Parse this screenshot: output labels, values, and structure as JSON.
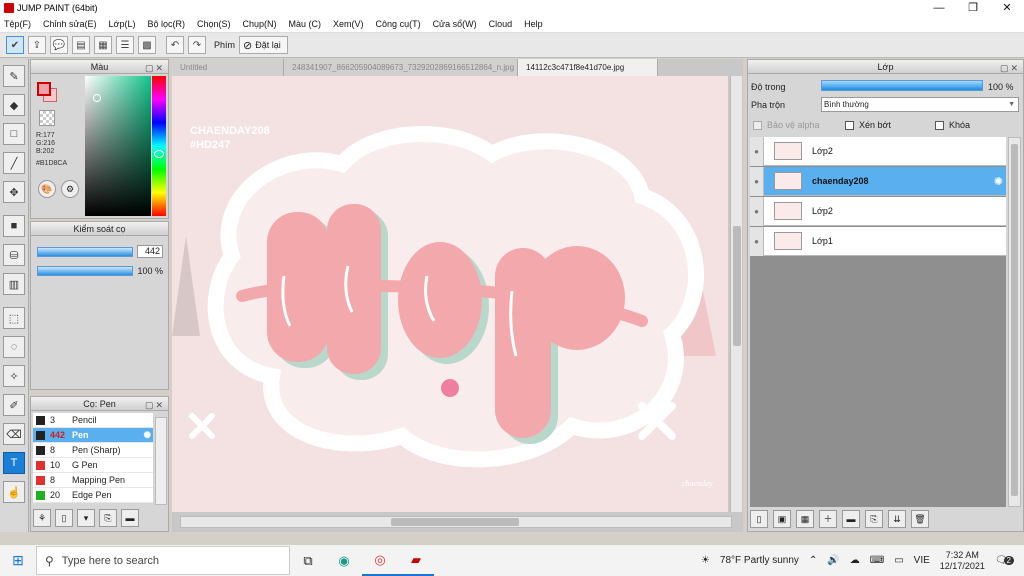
{
  "window": {
    "title": "JUMP PAINT (64bit)",
    "min": "—",
    "max": "❐",
    "close": "✕"
  },
  "menu": [
    "Tệp(F)",
    "Chỉnh sửa(E)",
    "Lớp(L)",
    "Bộ lọc(R)",
    "Chọn(S)",
    "Chụp(N)",
    "Màu (C)",
    "Xem(V)",
    "Công cụ(T)",
    "Cửa sổ(W)",
    "Cloud",
    "Help"
  ],
  "toolbar": {
    "shortcut_label": "Phím",
    "reset_label": "Đặt lại"
  },
  "color_panel": {
    "title": "Màu",
    "r": "R:177",
    "g": "G:216",
    "b": "B:202",
    "hex": "#B1D8CA"
  },
  "brush_control": {
    "title": "Kiểm soát cọ",
    "size": "442",
    "opacity": "100 %"
  },
  "brush_panel": {
    "title": "Cọ: Pen",
    "items": [
      {
        "size": "3",
        "name": "Pencil",
        "color": "#222222"
      },
      {
        "size": "442",
        "name": "Pen",
        "color": "#222222",
        "selected": true
      },
      {
        "size": "8",
        "name": "Pen (Sharp)",
        "color": "#222222"
      },
      {
        "size": "10",
        "name": "G Pen",
        "color": "#e03030"
      },
      {
        "size": "8",
        "name": "Mapping Pen",
        "color": "#e03030"
      },
      {
        "size": "20",
        "name": "Edge Pen",
        "color": "#20b020"
      }
    ]
  },
  "tabs": [
    {
      "label": "Untitled",
      "active": false
    },
    {
      "label": "248341907_866205904089673_7329202869166512864_n.jpg",
      "active": false
    },
    {
      "label": "14112c3c471f8e41d70e.jpg",
      "active": true
    }
  ],
  "artwork": {
    "watermark_line1": "CHAENDAY208",
    "watermark_line2": "#HD247",
    "word": "Đẹp",
    "signature": "chaenday"
  },
  "layer_panel": {
    "title": "Lớp",
    "opacity_label": "Độ trong",
    "opacity_value": "100 %",
    "blend_label": "Pha trộn",
    "blend_value": "Bình thường",
    "protect_alpha": "Bảo vệ alpha",
    "clipping": "Xén bớt",
    "lock": "Khóa",
    "layers": [
      {
        "name": "Lớp2",
        "selected": false
      },
      {
        "name": "chaenday208",
        "selected": true
      },
      {
        "name": "Lớp2",
        "selected": false
      },
      {
        "name": "Lớp1",
        "selected": false
      }
    ]
  },
  "taskbar": {
    "search_placeholder": "Type here to search",
    "weather": "78°F  Partly sunny",
    "lang": "VIE",
    "time": "7:32 AM",
    "date": "12/17/2021",
    "notif_count": "2"
  }
}
